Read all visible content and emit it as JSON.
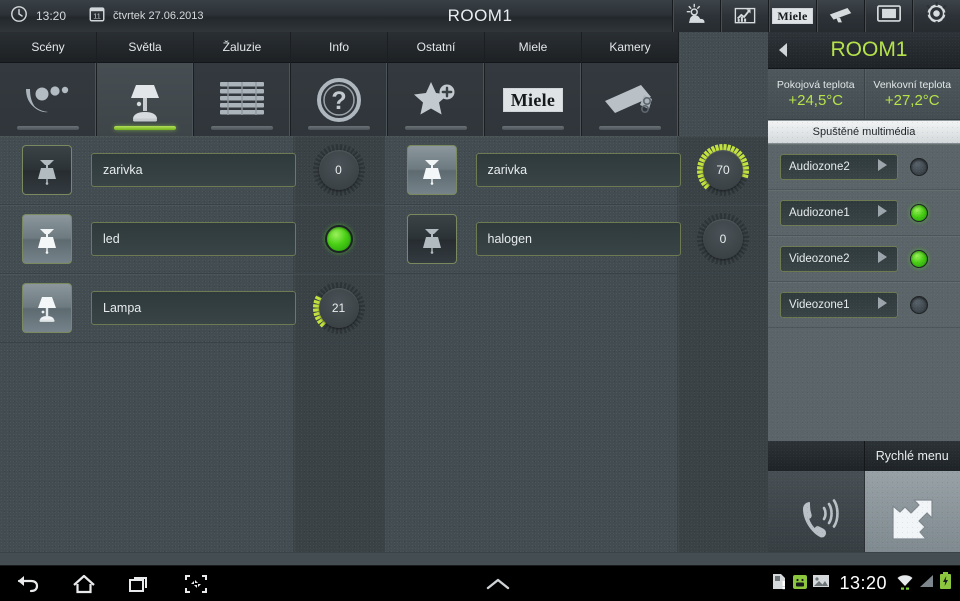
{
  "statusbar": {
    "clock_icon": "clock-icon",
    "time": "13:20",
    "calendar_icon": "calendar-icon",
    "calendar_day": "11",
    "date": "čtvrtek  27.06.2013",
    "title": "ROOM1",
    "buttons": [
      {
        "name": "weather-icon",
        "label": "weather"
      },
      {
        "name": "chart-icon",
        "label": "statistics"
      },
      {
        "name": "miele-logo-icon",
        "label": "Miele"
      },
      {
        "name": "camera-icon",
        "label": "cameras"
      },
      {
        "name": "tv-icon",
        "label": "multimedia"
      },
      {
        "name": "gear-icon",
        "label": "settings"
      }
    ]
  },
  "tabs": [
    {
      "label": "Scény",
      "icon": "scenes-icon",
      "active": false
    },
    {
      "label": "Světla",
      "icon": "lamp-icon",
      "active": true
    },
    {
      "label": "Žaluzie",
      "icon": "blinds-icon",
      "active": false
    },
    {
      "label": "Info",
      "icon": "question-icon",
      "active": false
    },
    {
      "label": "Ostatní",
      "icon": "star-plus-icon",
      "active": false
    },
    {
      "label": "Miele",
      "icon": "miele-logo-icon",
      "active": false
    },
    {
      "label": "Kamery",
      "icon": "camera-icon",
      "active": false
    }
  ],
  "lights": {
    "left": [
      {
        "name": "zarivka",
        "icon": "pendant-lamp-icon",
        "icon_state": "off",
        "control": "dial",
        "value": "0",
        "percent": 0
      },
      {
        "name": "led",
        "icon": "pendant-lamp-icon",
        "icon_state": "on",
        "control": "led",
        "value": "",
        "led_on": true
      },
      {
        "name": "Lampa",
        "icon": "table-lamp-icon",
        "icon_state": "on",
        "control": "dial",
        "value": "21",
        "percent": 21
      }
    ],
    "right": [
      {
        "name": "zarivka",
        "icon": "pendant-lamp-icon",
        "icon_state": "on",
        "control": "dial",
        "value": "70",
        "percent": 70
      },
      {
        "name": "halogen",
        "icon": "pendant-lamp-icon",
        "icon_state": "off",
        "control": "dial",
        "value": "0",
        "percent": 0
      }
    ]
  },
  "sidebar": {
    "back_icon": "back-arrow-icon",
    "room_title": "ROOM1",
    "temperatures": [
      {
        "label": "Pokojová teplota",
        "value": "+24,5°C"
      },
      {
        "label": "Venkovní teplota",
        "value": "+27,2°C"
      }
    ],
    "multimedia_header": "Spuštěné multimédia",
    "multimedia": [
      {
        "label": "Audiozone2",
        "play_icon": "play-icon",
        "led_on": false
      },
      {
        "label": "Audiozone1",
        "play_icon": "play-icon",
        "led_on": true
      },
      {
        "label": "Videozone2",
        "play_icon": "play-icon",
        "led_on": true
      },
      {
        "label": "Videozone1",
        "play_icon": "play-icon",
        "led_on": false
      }
    ],
    "quick_menu_label": "Rychlé menu",
    "quick_buttons": [
      {
        "icon": "phone-ringing-icon",
        "state": "dark"
      },
      {
        "icon": "shortcut-arrow-icon",
        "state": "light"
      }
    ]
  },
  "navbar": {
    "buttons": [
      {
        "icon": "back-icon"
      },
      {
        "icon": "home-icon"
      },
      {
        "icon": "recents-icon"
      },
      {
        "icon": "screenshot-icon"
      }
    ],
    "center_icon": "caret-up-icon",
    "tray": {
      "icons": [
        "sd-card-warning-icon",
        "android-apk-icon",
        "image-icon"
      ],
      "time": "13:20",
      "right_icons": [
        "wifi-icon",
        "signal-icon",
        "battery-charging-icon"
      ]
    }
  },
  "colors": {
    "accent_green": "#b6e24a",
    "led_green": "#49cf15",
    "background": "#434c50",
    "panel": "#5b6468",
    "title_text": "#e9edf0"
  }
}
